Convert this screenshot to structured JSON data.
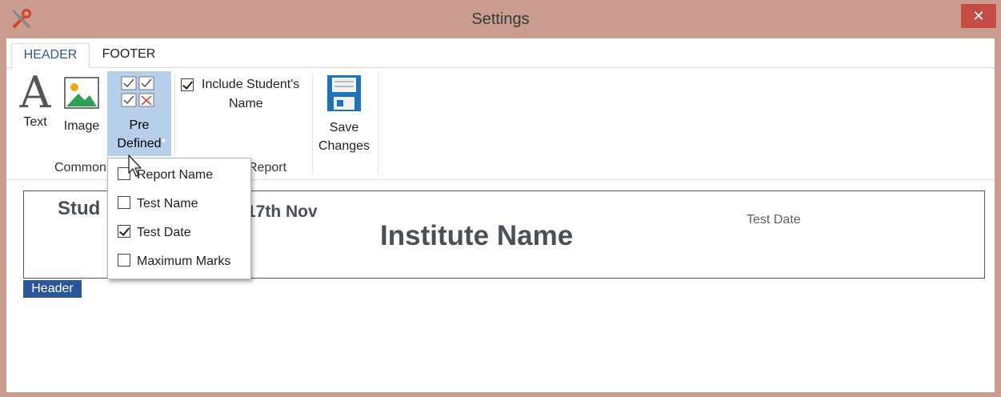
{
  "window": {
    "title": "Settings",
    "close_glyph": "✕",
    "app_icon": "tools-icon"
  },
  "tabs": [
    {
      "label": "HEADER",
      "active": true
    },
    {
      "label": "FOOTER",
      "active": false
    }
  ],
  "ribbon": {
    "text_label": "Text",
    "image_label": "Image",
    "predefined_line1": "Pre",
    "predefined_line2": "Defined",
    "include_label_line1": "Include Student's",
    "include_label_line2": "Name",
    "include_checked": true,
    "save_line1": "Save",
    "save_line2": "Changes",
    "group_common": "Common",
    "group_report": "Report"
  },
  "preview": {
    "student_fragment": "Stud",
    "date_fragment": "17th Nov",
    "institute_name": "Institute Name",
    "test_date": "Test Date",
    "section_badge": "Header"
  },
  "dropdown": {
    "items": [
      {
        "label": "Report Name",
        "checked": false
      },
      {
        "label": "Test Name",
        "checked": false
      },
      {
        "label": "Test Date",
        "checked": true
      },
      {
        "label": "Maximum Marks",
        "checked": false
      }
    ]
  },
  "colors": {
    "frame": "#c99d90",
    "close": "#c74b45",
    "accent": "#2b579a",
    "selected": "#b6cfea",
    "save_icon": "#1e73be"
  }
}
